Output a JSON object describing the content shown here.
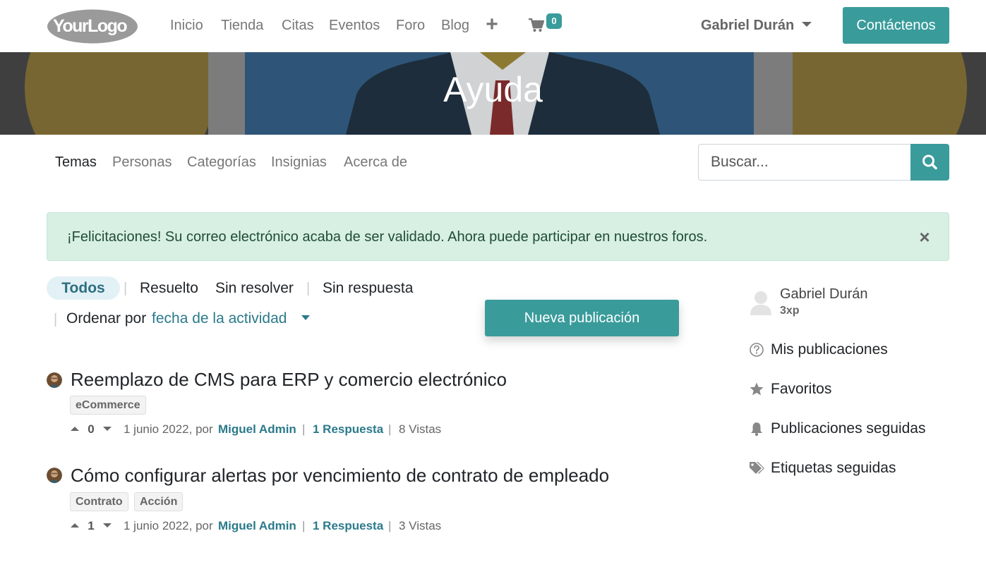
{
  "header": {
    "logo_text": "YourLogo",
    "nav": [
      "Inicio",
      "Tienda",
      "Citas",
      "Eventos",
      "Foro",
      "Blog"
    ],
    "cart_count": "0",
    "user_name": "Gabriel Durán",
    "contact_label": "Contáctenos"
  },
  "banner": {
    "title": "Ayuda"
  },
  "forum_nav": {
    "links": [
      "Temas",
      "Personas",
      "Categorías",
      "Insignias",
      "Acerca de"
    ],
    "active": "Temas",
    "search_placeholder": "Buscar..."
  },
  "alert": {
    "message": "¡Felicitaciones! Su correo electrónico acaba de ser validado. Ahora puede participar en nuestros foros."
  },
  "filters": {
    "tabs": [
      "Todos",
      "Resuelto",
      "Sin resolver",
      "Sin respuesta"
    ],
    "active": "Todos",
    "sort_label": "Ordenar por",
    "sort_value": "fecha de la actividad",
    "new_post_label": "Nueva publicación"
  },
  "posts": [
    {
      "title": "Reemplazo de CMS para ERP y comercio electrónico",
      "tags": [
        "eCommerce"
      ],
      "votes": "0",
      "date": "1 junio 2022, por",
      "author": "Miguel Admin",
      "answers": "1 Respuesta",
      "views": "8 Vistas"
    },
    {
      "title": "Cómo configurar alertas por vencimiento de contrato de empleado",
      "tags": [
        "Contrato",
        "Acción"
      ],
      "votes": "1",
      "date": "1 junio 2022, por",
      "author": "Miguel Admin",
      "answers": "1 Respuesta",
      "views": "3 Vistas"
    }
  ],
  "sidebar": {
    "user_name": "Gabriel Durán",
    "xp": "3xp",
    "links": [
      {
        "label": "Mis publicaciones",
        "icon": "question-circle-icon"
      },
      {
        "label": "Favoritos",
        "icon": "star-icon"
      },
      {
        "label": "Publicaciones seguidas",
        "icon": "bell-icon"
      },
      {
        "label": "Etiquetas seguidas",
        "icon": "tags-icon"
      }
    ]
  },
  "colors": {
    "primary": "#3a9b9b",
    "alert_bg": "#d8efe3",
    "alert_text": "#1f4d33",
    "link": "#2b7a8b",
    "pill_bg": "#e2f1f6"
  }
}
